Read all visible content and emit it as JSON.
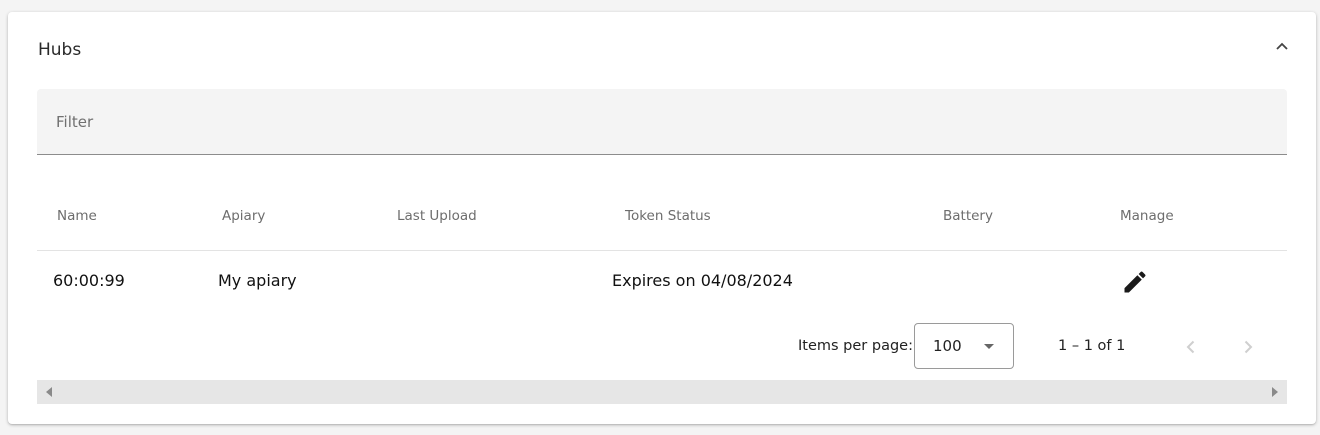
{
  "panel": {
    "title": "Hubs"
  },
  "filter": {
    "placeholder": "Filter",
    "value": ""
  },
  "table": {
    "columns": [
      "Name",
      "Apiary",
      "Last Upload",
      "Token Status",
      "Battery",
      "Manage"
    ],
    "rows": [
      {
        "name": "60:00:99",
        "apiary": "My apiary",
        "last_upload": "",
        "token_status": "Expires on 04/08/2024",
        "battery": ""
      }
    ]
  },
  "paginator": {
    "items_per_page_label": "Items per page:",
    "items_per_page_value": "100",
    "range_label": "1 – 1 of 1"
  },
  "icons": {
    "collapse": "chevron-up-icon",
    "edit": "pencil-icon",
    "prev": "chevron-left-icon",
    "next": "chevron-right-icon"
  },
  "colors": {
    "page_background": "#f4f4f4",
    "card_background": "#ffffff",
    "filter_background": "#f4f4f4"
  }
}
